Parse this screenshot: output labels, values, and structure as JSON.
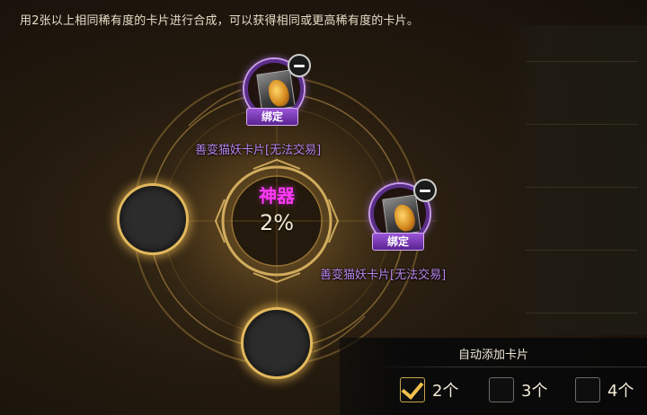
{
  "instruction": "用2张以上相同稀有度的卡片进行合成，可以获得相同或更高稀有度的卡片。",
  "center": {
    "rarity": "神器",
    "rate": "2%"
  },
  "cards": [
    {
      "bind_label": "绑定",
      "name": "善变猫妖卡片[无法交易]",
      "icon": "cat-demon-card-art"
    },
    {
      "bind_label": "绑定",
      "name": "善变猫妖卡片[无法交易]",
      "icon": "cat-demon-card-art"
    }
  ],
  "auto_add": {
    "title": "自动添加卡片",
    "options": [
      {
        "label": "2个",
        "checked": true
      },
      {
        "label": "3个",
        "checked": false
      },
      {
        "label": "4个",
        "checked": false
      }
    ]
  },
  "colors": {
    "rarity": "#ff3cf5",
    "card_name": "#b986ee",
    "slot_glow": "#e2b85c",
    "check": "#f2c14c"
  }
}
